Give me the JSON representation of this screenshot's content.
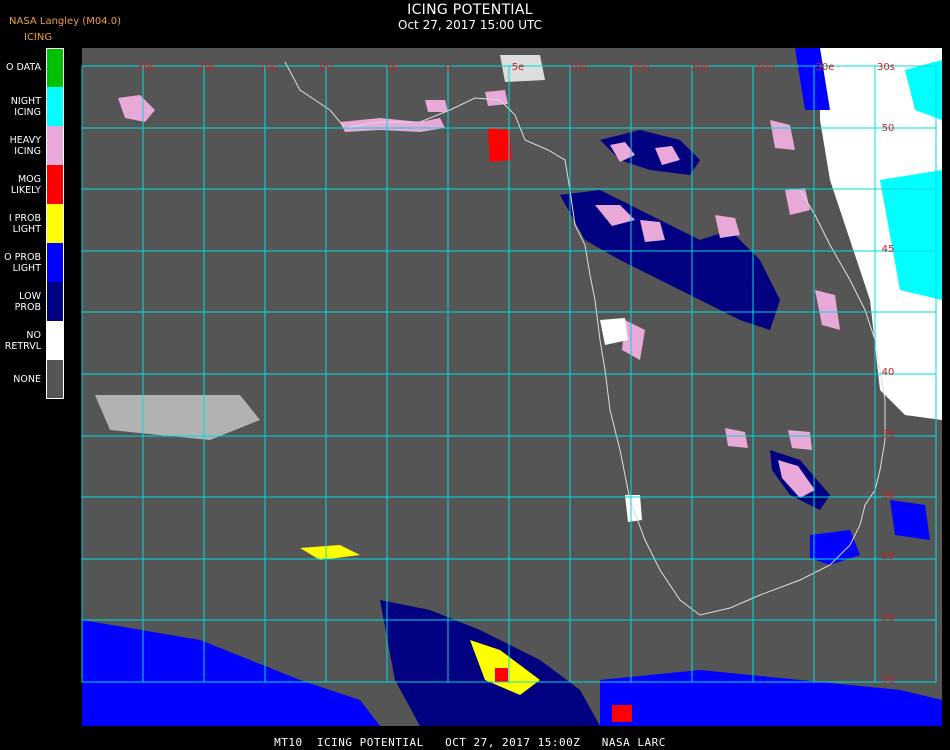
{
  "header": {
    "producer": "NASA Langley (M04.0)",
    "product": "ICING",
    "title": "ICING POTENTIAL",
    "timestamp": "Oct 27, 2017 15:00 UTC"
  },
  "legend": [
    {
      "label": "O DATA",
      "color": "#00c000"
    },
    {
      "label": "NIGHT\nICING",
      "color": "#00ffff"
    },
    {
      "label": "HEAVY\nICING",
      "color": "#e8a8d8"
    },
    {
      "label": "MOG\nLIKELY",
      "color": "#ff0000"
    },
    {
      "label": "I PROB\nLIGHT",
      "color": "#ffff00"
    },
    {
      "label": "O PROB\nLIGHT",
      "color": "#0000ff"
    },
    {
      "label": "LOW\nPROB",
      "color": "#000080"
    },
    {
      "label": "NO\nRETRVL",
      "color": "#ffffff"
    },
    {
      "label": "NONE",
      "color": "#555555"
    }
  ],
  "map": {
    "background_color": "#555555",
    "grid_color": "#00dddd",
    "tick_label_color": "#cc2020",
    "coast_color": "#dddddd",
    "top_labels": [
      "30s",
      "20s",
      "10s",
      "00",
      "0s",
      "0",
      "5e",
      "10e",
      "20e",
      "30e",
      "40e",
      "30e",
      "30s"
    ],
    "right_labels": [
      "50",
      "45",
      "40",
      "35",
      "30",
      "25",
      "20",
      "15"
    ]
  },
  "footer": "MT10  ICING POTENTIAL   OCT 27, 2017 15:00Z   NASA LARC"
}
